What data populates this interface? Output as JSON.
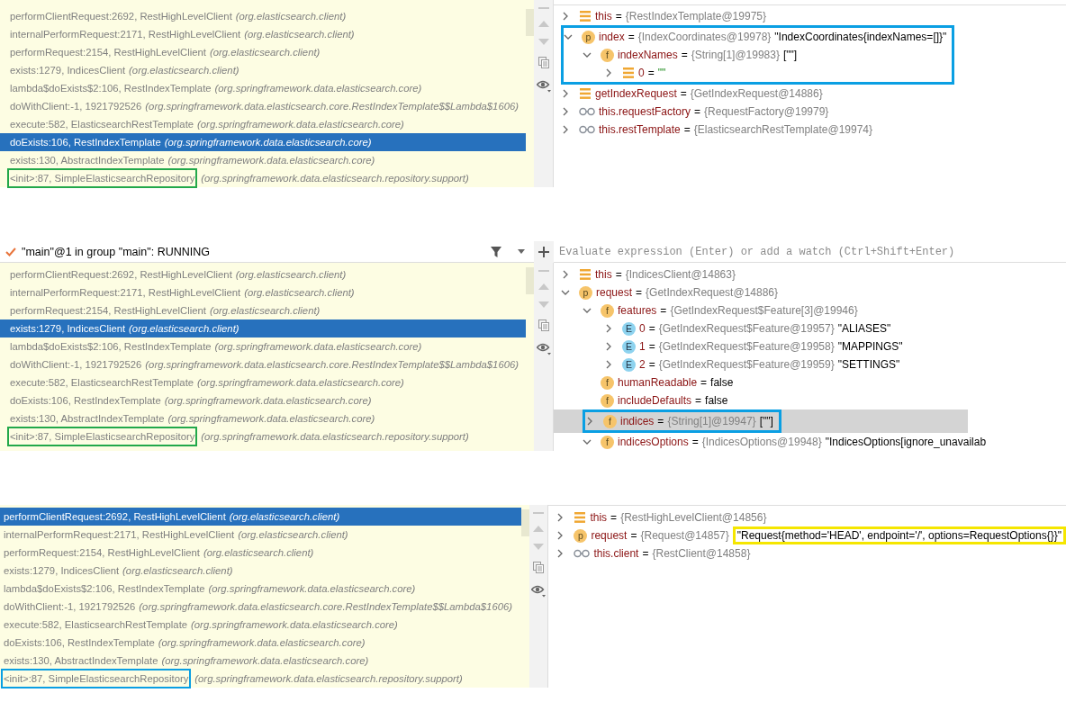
{
  "panels": [
    {
      "toolbar": [
        {
          "kind": "minus"
        },
        {
          "kind": "up"
        },
        {
          "kind": "down"
        },
        {
          "kind": "copy"
        },
        {
          "kind": "eye"
        }
      ],
      "frames": [
        {
          "location": "performClientRequest:2692, RestHighLevelClient",
          "package": "(org.elasticsearch.client)",
          "selected": false
        },
        {
          "location": "internalPerformRequest:2171, RestHighLevelClient",
          "package": "(org.elasticsearch.client)",
          "selected": false
        },
        {
          "location": "performRequest:2154, RestHighLevelClient",
          "package": "(org.elasticsearch.client)",
          "selected": false
        },
        {
          "location": "exists:1279, IndicesClient",
          "package": "(org.elasticsearch.client)",
          "selected": false
        },
        {
          "location": "lambda$doExists$2:106, RestIndexTemplate",
          "package": "(org.springframework.data.elasticsearch.core)",
          "selected": false
        },
        {
          "location": "doWithClient:-1, 1921792526",
          "package": "(org.springframework.data.elasticsearch.core.RestIndexTemplate$$Lambda$1606)",
          "selected": false
        },
        {
          "location": "execute:582, ElasticsearchRestTemplate",
          "package": "(org.springframework.data.elasticsearch.core)",
          "selected": false
        },
        {
          "location": "doExists:106, RestIndexTemplate",
          "package": "(org.springframework.data.elasticsearch.core)",
          "selected": true
        },
        {
          "location": "exists:130, AbstractIndexTemplate",
          "package": "(org.springframework.data.elasticsearch.core)",
          "selected": false
        },
        {
          "location": "<init>:87, SimpleElasticsearchRepository",
          "package": "(org.springframework.data.elasticsearch.repository.support)",
          "selected": false,
          "highlight": {
            "color": "#22a84a"
          }
        }
      ],
      "variables": [
        {
          "kind": "local",
          "name": "this",
          "eq": "=",
          "type": "{RestIndexTemplate@19975}",
          "expanded": false,
          "selected": false
        },
        {
          "kind": "param",
          "badge": "p",
          "name": "index",
          "eq": "=",
          "type": "{IndexCoordinates@19978}",
          "value": "\"IndexCoordinates{indexNames=[]}\"",
          "expanded": true,
          "selected": false,
          "highlight": {
            "color": "#0a9fe3"
          },
          "children": [
            {
              "kind": "field",
              "badge": "f",
              "name": "indexNames",
              "eq": "=",
              "type": "{String[1]@19983}",
              "value": "[\"\"]",
              "expanded": true,
              "selected": false,
              "children": [
                {
                  "kind": "local",
                  "name": "0",
                  "eq": "=",
                  "value": "\"\"",
                  "string": true,
                  "expanded": false,
                  "selected": false
                }
              ]
            }
          ]
        },
        {
          "kind": "local",
          "name": "getIndexRequest",
          "eq": "=",
          "type": "{GetIndexRequest@14886}",
          "expanded": false,
          "selected": false
        },
        {
          "kind": "watch",
          "name": "this.requestFactory",
          "eq": "=",
          "type": "{RequestFactory@19979}",
          "expanded": false,
          "selected": false
        },
        {
          "kind": "watch",
          "name": "this.restTemplate",
          "eq": "=",
          "type": "{ElasticsearchRestTemplate@19974}",
          "expanded": false,
          "selected": false
        }
      ]
    },
    {
      "thread": "\"main\"@1 in group \"main\": RUNNING",
      "watch_placeholder": "Evaluate expression (Enter) or add a watch (Ctrl+Shift+Enter)",
      "toolbar": [
        {
          "kind": "plus"
        },
        {
          "kind": "minus"
        },
        {
          "kind": "up"
        },
        {
          "kind": "down"
        },
        {
          "kind": "copy"
        },
        {
          "kind": "eye"
        }
      ],
      "frames": [
        {
          "location": "performClientRequest:2692, RestHighLevelClient",
          "package": "(org.elasticsearch.client)",
          "selected": false
        },
        {
          "location": "internalPerformRequest:2171, RestHighLevelClient",
          "package": "(org.elasticsearch.client)",
          "selected": false
        },
        {
          "location": "performRequest:2154, RestHighLevelClient",
          "package": "(org.elasticsearch.client)",
          "selected": false
        },
        {
          "location": "exists:1279, IndicesClient",
          "package": "(org.elasticsearch.client)",
          "selected": true
        },
        {
          "location": "lambda$doExists$2:106, RestIndexTemplate",
          "package": "(org.springframework.data.elasticsearch.core)",
          "selected": false
        },
        {
          "location": "doWithClient:-1, 1921792526",
          "package": "(org.springframework.data.elasticsearch.core.RestIndexTemplate$$Lambda$1606)",
          "selected": false
        },
        {
          "location": "execute:582, ElasticsearchRestTemplate",
          "package": "(org.springframework.data.elasticsearch.core)",
          "selected": false
        },
        {
          "location": "doExists:106, RestIndexTemplate",
          "package": "(org.springframework.data.elasticsearch.core)",
          "selected": false
        },
        {
          "location": "exists:130, AbstractIndexTemplate",
          "package": "(org.springframework.data.elasticsearch.core)",
          "selected": false
        },
        {
          "location": "<init>:87, SimpleElasticsearchRepository",
          "package": "(org.springframework.data.elasticsearch.repository.support)",
          "selected": false,
          "highlight": {
            "color": "#22a84a"
          }
        }
      ],
      "variables": [
        {
          "kind": "local",
          "name": "this",
          "eq": "=",
          "type": "{IndicesClient@14863}",
          "expanded": false,
          "selected": false
        },
        {
          "kind": "param",
          "badge": "p",
          "name": "request",
          "eq": "=",
          "type": "{GetIndexRequest@14886}",
          "expanded": true,
          "selected": false,
          "children": [
            {
              "kind": "field",
              "badge": "f",
              "name": "features",
              "eq": "=",
              "type": "{GetIndexRequest$Feature[3]@19946}",
              "expanded": true,
              "selected": false,
              "children": [
                {
                  "kind": "enum",
                  "badge": "E",
                  "name": "0",
                  "eq": "=",
                  "type": "{GetIndexRequest$Feature@19957}",
                  "value": "\"ALIASES\"",
                  "expanded": false,
                  "selected": false
                },
                {
                  "kind": "enum",
                  "badge": "E",
                  "name": "1",
                  "eq": "=",
                  "type": "{GetIndexRequest$Feature@19958}",
                  "value": "\"MAPPINGS\"",
                  "expanded": false,
                  "selected": false
                },
                {
                  "kind": "enum",
                  "badge": "E",
                  "name": "2",
                  "eq": "=",
                  "type": "{GetIndexRequest$Feature@19959}",
                  "value": "\"SETTINGS\"",
                  "expanded": false,
                  "selected": false
                }
              ]
            },
            {
              "kind": "field",
              "badge": "f",
              "name": "humanReadable",
              "eq": "=",
              "value": "false",
              "selected": false
            },
            {
              "kind": "field",
              "badge": "f",
              "name": "includeDefaults",
              "eq": "=",
              "value": "false",
              "selected": false
            },
            {
              "kind": "field",
              "badge": "f",
              "name": "indices",
              "eq": "=",
              "type": "{String[1]@19947}",
              "value": "[\"\"]",
              "expanded": false,
              "selected": true,
              "highlight": {
                "color": "#0a9fe3"
              }
            },
            {
              "kind": "field",
              "badge": "f",
              "name": "indicesOptions",
              "eq": "=",
              "type": "{IndicesOptions@19948}",
              "value": "\"IndicesOptions[ignore_unavailab",
              "expanded": true,
              "selected": false
            }
          ]
        }
      ]
    },
    {
      "toolbar": [
        {
          "kind": "minus"
        },
        {
          "kind": "up"
        },
        {
          "kind": "down"
        },
        {
          "kind": "copy"
        },
        {
          "kind": "eye"
        }
      ],
      "frames": [
        {
          "location": "performClientRequest:2692, RestHighLevelClient",
          "package": "(org.elasticsearch.client)",
          "selected": true
        },
        {
          "location": "internalPerformRequest:2171, RestHighLevelClient",
          "package": "(org.elasticsearch.client)",
          "selected": false
        },
        {
          "location": "performRequest:2154, RestHighLevelClient",
          "package": "(org.elasticsearch.client)",
          "selected": false
        },
        {
          "location": "exists:1279, IndicesClient",
          "package": "(org.elasticsearch.client)",
          "selected": false
        },
        {
          "location": "lambda$doExists$2:106, RestIndexTemplate",
          "package": "(org.springframework.data.elasticsearch.core)",
          "selected": false
        },
        {
          "location": "doWithClient:-1, 1921792526",
          "package": "(org.springframework.data.elasticsearch.core.RestIndexTemplate$$Lambda$1606)",
          "selected": false
        },
        {
          "location": "execute:582, ElasticsearchRestTemplate",
          "package": "(org.springframework.data.elasticsearch.core)",
          "selected": false
        },
        {
          "location": "doExists:106, RestIndexTemplate",
          "package": "(org.springframework.data.elasticsearch.core)",
          "selected": false
        },
        {
          "location": "exists:130, AbstractIndexTemplate",
          "package": "(org.springframework.data.elasticsearch.core)",
          "selected": false
        },
        {
          "location": "<init>:87, SimpleElasticsearchRepository",
          "package": "(org.springframework.data.elasticsearch.repository.support)",
          "selected": false,
          "highlight": {
            "color": "#0a9fe3"
          }
        }
      ],
      "variables": [
        {
          "kind": "local",
          "name": "this",
          "eq": "=",
          "type": "{RestHighLevelClient@14856}",
          "expanded": false,
          "selected": false
        },
        {
          "kind": "param",
          "badge": "p",
          "name": "request",
          "eq": "=",
          "type": "{Request@14857}",
          "value": "\"Request{method='HEAD', endpoint='/', options=RequestOptions{}}\"",
          "expanded": false,
          "selected": false,
          "value_highlight": {
            "color": "#f5e600"
          }
        },
        {
          "kind": "watch",
          "name": "this.client",
          "eq": "=",
          "type": "{RestClient@14858}",
          "expanded": false,
          "selected": false
        }
      ]
    }
  ]
}
